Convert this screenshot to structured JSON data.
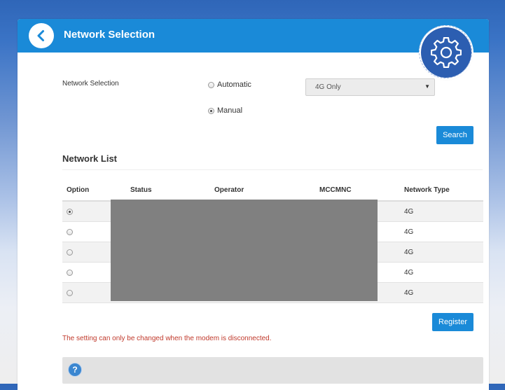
{
  "header": {
    "title": "Network Selection",
    "back_icon": "chevron-left-icon",
    "settings_icon": "gear-icon"
  },
  "form": {
    "selection_label": "Network Selection",
    "options": [
      {
        "label": "Automatic",
        "checked": false
      },
      {
        "label": "Manual",
        "checked": true
      }
    ],
    "mode_select": {
      "value": "4G Only"
    },
    "search_label": "Search"
  },
  "network_list": {
    "title": "Network List",
    "columns": [
      "Option",
      "Status",
      "Operator",
      "MCCMNC",
      "Network Type"
    ],
    "rows": [
      {
        "selected": true,
        "status": "",
        "operator": "",
        "mccmnc": "",
        "network_type": "4G"
      },
      {
        "selected": false,
        "status": "",
        "operator": "",
        "mccmnc": "",
        "network_type": "4G"
      },
      {
        "selected": false,
        "status": "",
        "operator": "",
        "mccmnc": "",
        "network_type": "4G"
      },
      {
        "selected": false,
        "status": "",
        "operator": "",
        "mccmnc": "",
        "network_type": "4G"
      },
      {
        "selected": false,
        "status": "",
        "operator": "",
        "mccmnc": "",
        "network_type": "4G"
      }
    ],
    "register_label": "Register"
  },
  "warning": "The setting can only be changed when the modem is disconnected.",
  "help": {
    "icon": "help-icon",
    "glyph": "?"
  },
  "colors": {
    "accent": "#1a8ad8",
    "warning": "#c0392b",
    "badge": "#2c5eb1"
  }
}
